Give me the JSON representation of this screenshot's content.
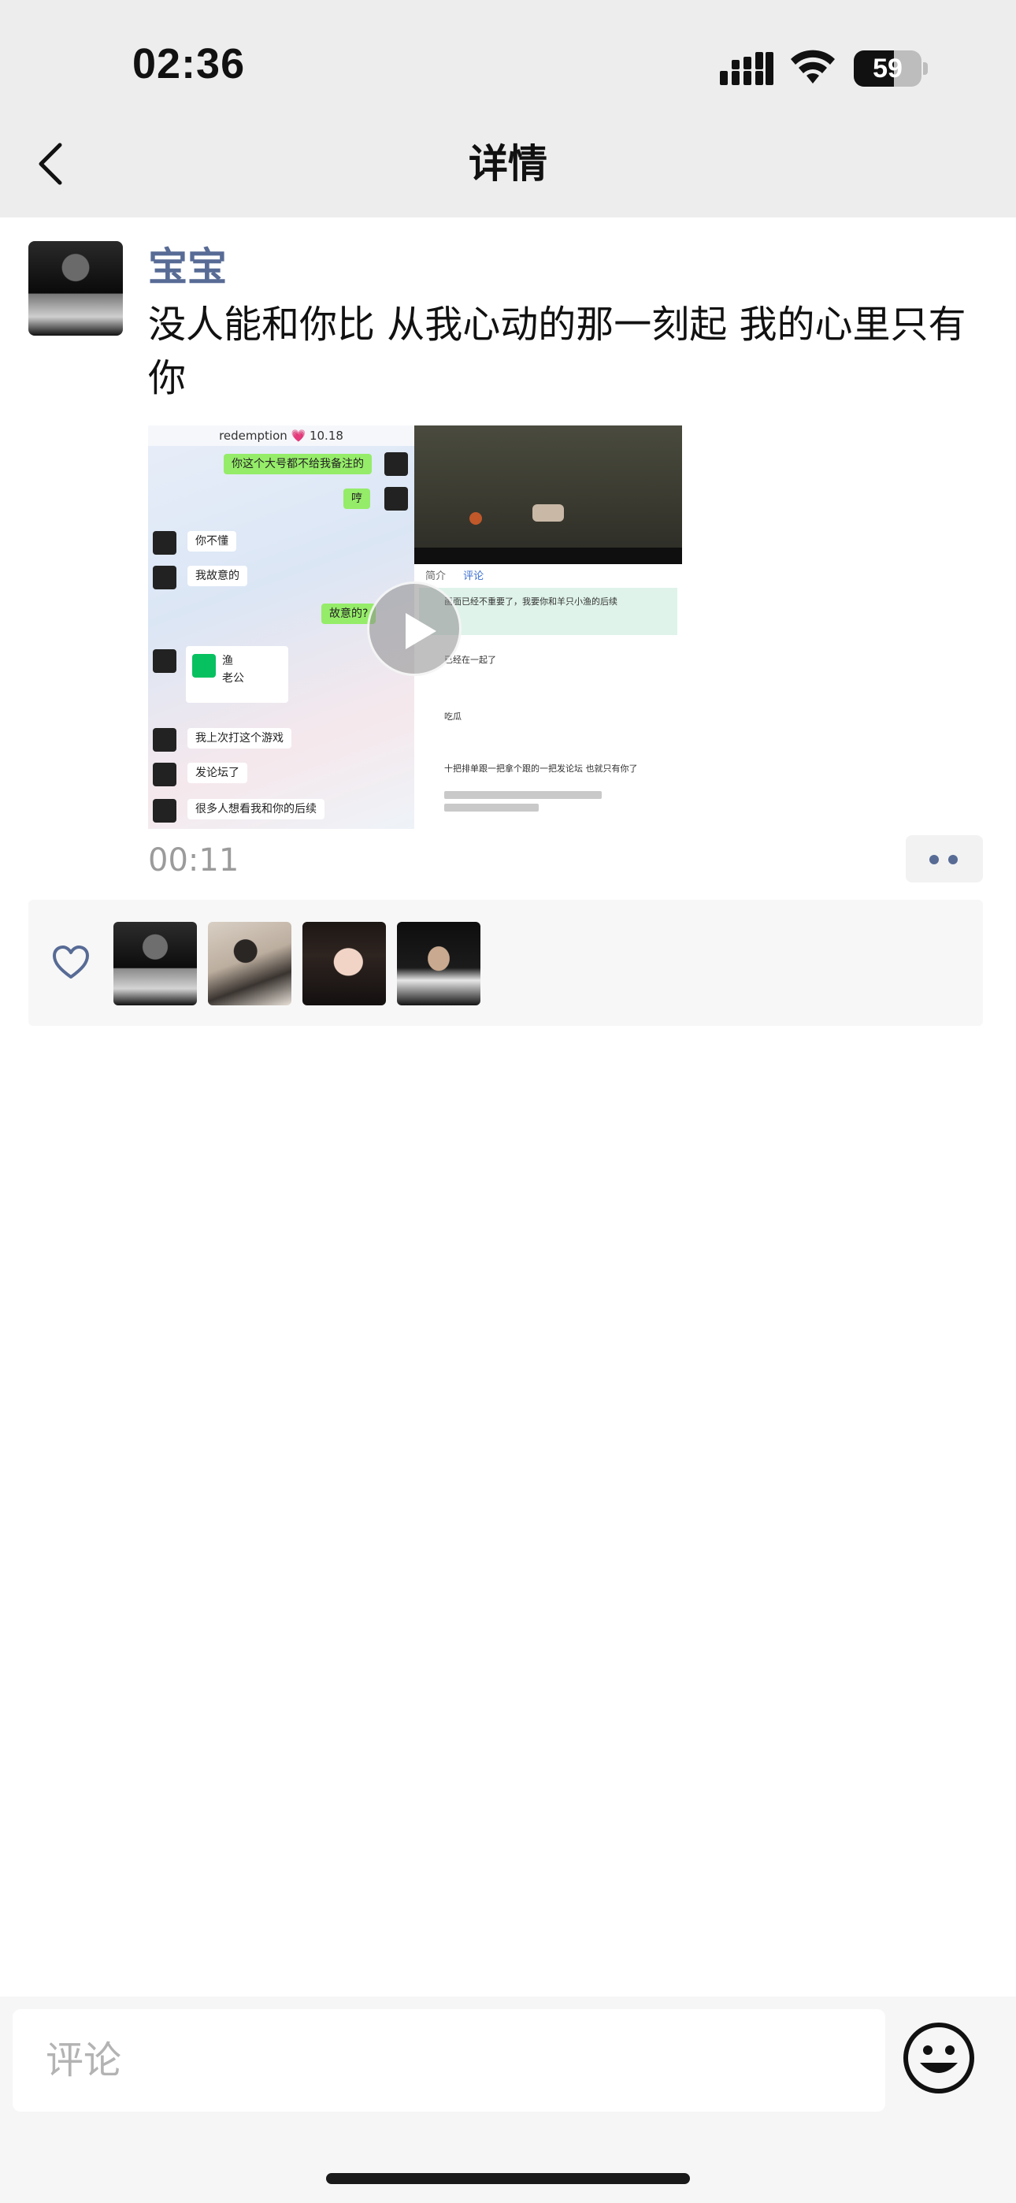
{
  "status_bar": {
    "time": "02:36",
    "battery": "59",
    "battery_level_percent": 59,
    "signal_icon": "cellular-signal-icon",
    "wifi_icon": "wifi-icon"
  },
  "nav": {
    "title": "详情",
    "back_icon": "chevron-left-icon"
  },
  "post": {
    "author": "宝宝",
    "text": "没人能和你比 从我心动的那一刻起 我的心里只有你",
    "video": {
      "duration": "00:11",
      "play_icon": "play-icon",
      "chat_header": "redemption 💗 10.18",
      "chat_messages": [
        "你这个大号都不给我备注的",
        "哼",
        "你不懂",
        "我故意的",
        "故意的?",
        "渔",
        "老公",
        "我上次打这个游戏",
        "发论坛了",
        "很多人想看我和你的后续"
      ],
      "comments_tabs": [
        "简介",
        "评论"
      ],
      "comments": [
        "画面已经不重要了，我要你和羊只小渔的后续",
        "已经在一起了",
        "吃瓜",
        "十把排单跟一把拿个跟的一把发论坛 也就只有你了"
      ]
    },
    "more_icon": "more-dots-icon"
  },
  "likes": {
    "heart_icon": "heart-outline-icon",
    "avatars": [
      "liker-avatar-1",
      "liker-avatar-2",
      "liker-avatar-3",
      "liker-avatar-4"
    ]
  },
  "comment_bar": {
    "placeholder": "评论",
    "emoji_icon": "emoji-smile-icon"
  },
  "colors": {
    "nav_background": "#ededed",
    "username_link": "#576b95",
    "likes_background": "#f7f7f7",
    "muted_text": "#9b9b9b"
  }
}
